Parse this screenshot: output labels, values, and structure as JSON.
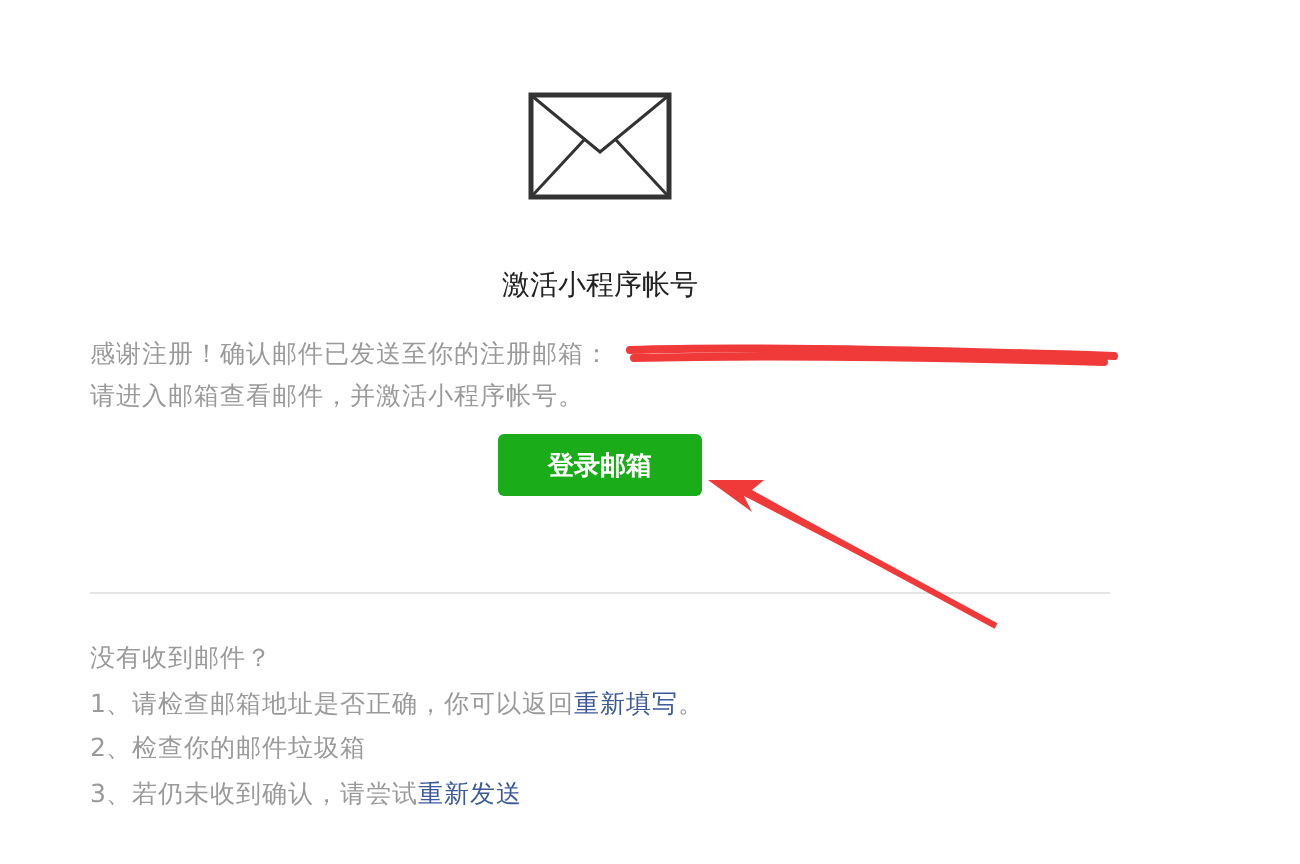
{
  "title": "激活小程序帐号",
  "message": {
    "line_1": "感谢注册！确认邮件已发送至你的注册邮箱：",
    "line_2": "请进入邮箱查看邮件，并激活小程序帐号。"
  },
  "button": "登录邮箱",
  "help": {
    "heading": "没有收到邮件？",
    "items": [
      {
        "text": "1、请检查邮箱地址是否正确，你可以返回",
        "link": "重新填写",
        "after": "。"
      },
      {
        "text": "2、检查你的邮件垃圾箱"
      },
      {
        "text": "3、若仍未收到确认，请尝试",
        "link": "重新发送"
      }
    ]
  }
}
